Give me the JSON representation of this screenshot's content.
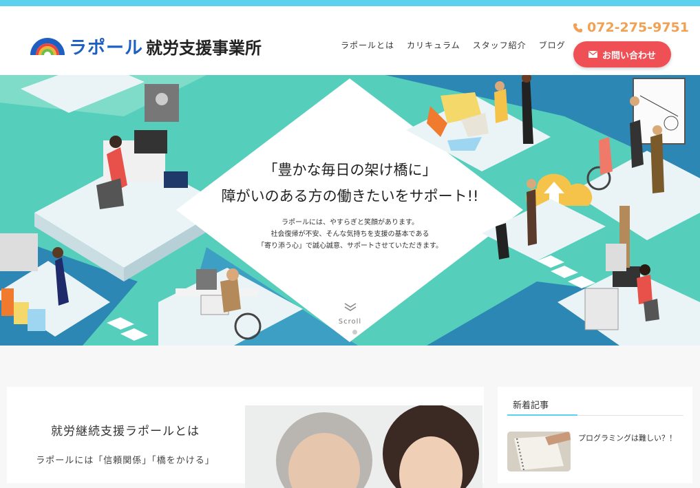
{
  "site": {
    "logo_brand": "ラポール",
    "logo_rest": "就労支援事業所"
  },
  "nav": {
    "items": [
      {
        "label": "ラポールとは"
      },
      {
        "label": "カリキュラム"
      },
      {
        "label": "スタッフ紹介"
      },
      {
        "label": "ブログ"
      }
    ]
  },
  "contact": {
    "phone": "072-275-9751",
    "button_label": "お問い合わせ"
  },
  "hero": {
    "catch_line1": "「豊かな毎日の架け橋に」",
    "catch_line2": "障がいのある方の働きたいをサポート!!",
    "description": [
      "ラポールには、やすらぎと笑顔があります。",
      "社会復帰が不安、そんな気持ちを支援の基本である",
      "「寄り添う心」で誠心誠意、サポートさせていただきます。"
    ],
    "scroll_label": "Scroll"
  },
  "about": {
    "title": "就労継続支援ラポールとは",
    "text": "ラポールには「信頼関係」「橋をかける」"
  },
  "sidebar": {
    "title": "新着記事",
    "posts": [
      {
        "title": "プログラミングは難しい？！"
      }
    ]
  },
  "colors": {
    "accent": "#5cd0ef",
    "brand": "#1f5fc2",
    "phone": "#f0a254",
    "button": "#ee5055",
    "hero_teal": "#55cfbb",
    "hero_blue": "#2d87b4"
  },
  "icons": {
    "phone": "phone-icon",
    "contact": "envelope-icon",
    "scroll": "chevron-double-down-icon"
  }
}
